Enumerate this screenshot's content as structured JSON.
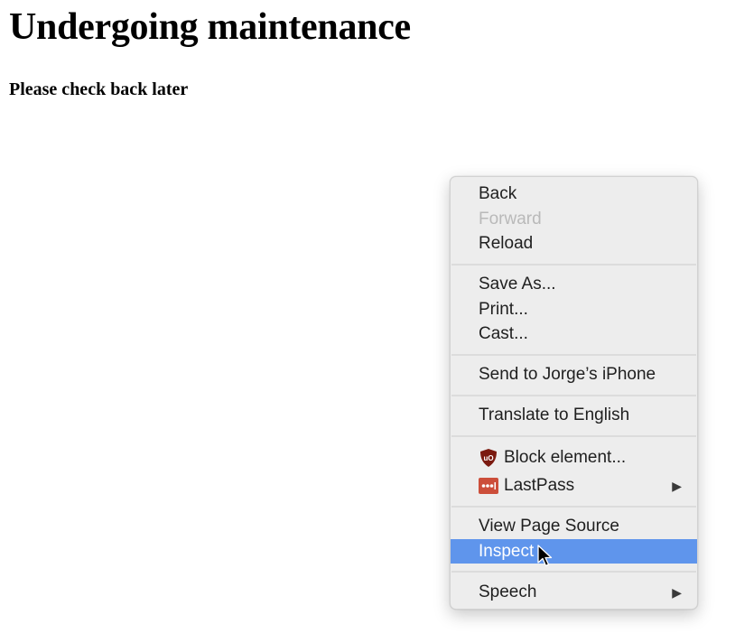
{
  "page": {
    "heading": "Undergoing maintenance",
    "subheading": "Please check back later"
  },
  "context_menu": {
    "highlight_color": "#5f95ec",
    "items": {
      "back": "Back",
      "forward": "Forward",
      "reload": "Reload",
      "save_as": "Save As...",
      "print": "Print...",
      "cast": "Cast...",
      "send_to_device": "Send to Jorge’s iPhone",
      "translate": "Translate to English",
      "block_element": "Block element...",
      "lastpass": "LastPass",
      "view_page_source": "View Page Source",
      "inspect": "Inspect",
      "speech": "Speech"
    },
    "icons": {
      "block_element": "ublock-origin-icon",
      "lastpass": "lastpass-icon",
      "submenu": "triangle-right-icon",
      "cursor": "mouse-pointer-icon"
    }
  }
}
